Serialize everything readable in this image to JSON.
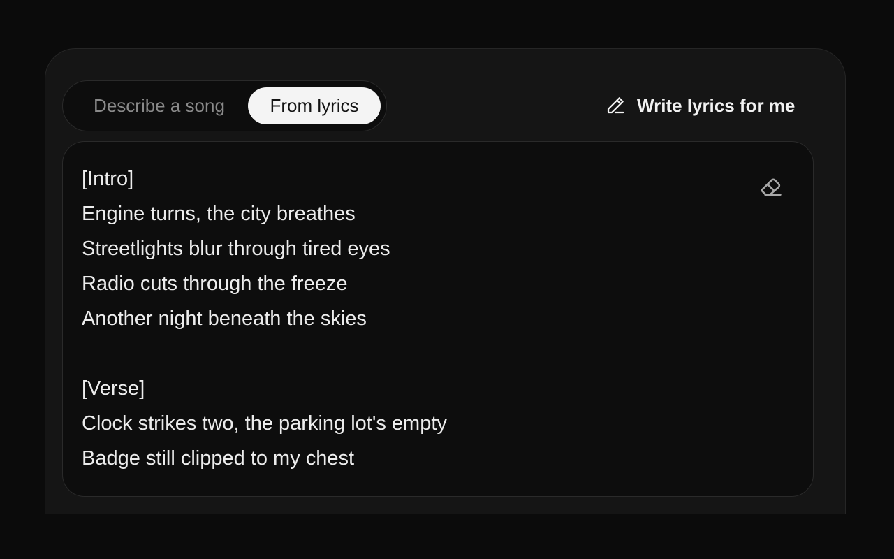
{
  "mode_toggle": {
    "describe_label": "Describe a song",
    "lyrics_label": "From lyrics",
    "active": "From lyrics"
  },
  "write_button": {
    "label": "Write lyrics for me",
    "icon": "pencil-icon"
  },
  "lyrics": {
    "text": "[Intro]\nEngine turns, the city breathes\nStreetlights blur through tired eyes\nRadio cuts through the freeze\nAnother night beneath the skies\n\n[Verse]\nClock strikes two, the parking lot's empty\nBadge still clipped to my chest",
    "clear_icon": "eraser-icon"
  },
  "colors": {
    "background": "#0b0b0b",
    "panel": "#151515",
    "input": "#0d0d0d",
    "active_tab": "#f4f4f4",
    "text": "#ececec",
    "muted_text": "#8a8a8a"
  }
}
